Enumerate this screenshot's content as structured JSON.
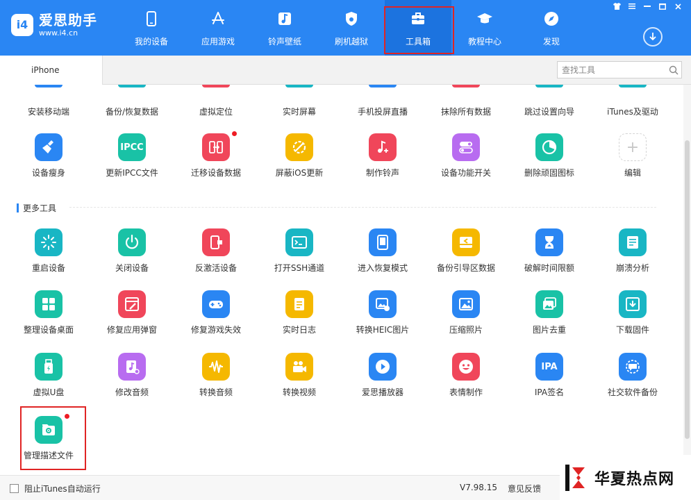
{
  "brand": {
    "name": "爱思助手",
    "url": "www.i4.cn",
    "mark": "i4"
  },
  "nav": [
    {
      "id": "my-device",
      "label": "我的设备",
      "icon": "phone-icon"
    },
    {
      "id": "apps-games",
      "label": "应用游戏",
      "icon": "app-store-icon"
    },
    {
      "id": "ringtones",
      "label": "铃声壁纸",
      "icon": "music-icon"
    },
    {
      "id": "flash-jailbreak",
      "label": "刷机越狱",
      "icon": "shield-icon"
    },
    {
      "id": "toolbox",
      "label": "工具箱",
      "icon": "toolbox-icon",
      "active": true
    },
    {
      "id": "tutorials",
      "label": "教程中心",
      "icon": "graduation-cap-icon"
    },
    {
      "id": "discover",
      "label": "发现",
      "icon": "compass-icon"
    }
  ],
  "device_tab": "iPhone",
  "search": {
    "placeholder": "查找工具"
  },
  "partial_row": [
    {
      "label": "安装移动端",
      "color": "#2a86f3"
    },
    {
      "label": "备份/恢复数据",
      "color": "#19b6c4"
    },
    {
      "label": "虚拟定位",
      "color": "#f0465a"
    },
    {
      "label": "实时屏幕",
      "color": "#19b6c4"
    },
    {
      "label": "手机投屏直播",
      "color": "#2a86f3"
    },
    {
      "label": "抹除所有数据",
      "color": "#f0465a"
    },
    {
      "label": "跳过设置向导",
      "color": "#19b6c4"
    },
    {
      "label": "iTunes及驱动",
      "color": "#19b6c4"
    }
  ],
  "row_top": [
    {
      "label": "设备瘦身",
      "icon": "broom-icon",
      "color": "#2a86f3"
    },
    {
      "label": "更新IPCC文件",
      "icon": "ipcc-icon",
      "text": "IPCC",
      "color": "#19c2a6"
    },
    {
      "label": "迁移设备数据",
      "icon": "transfer-icon",
      "color": "#f0465a",
      "dot": true
    },
    {
      "label": "屏蔽iOS更新",
      "icon": "block-update-icon",
      "color": "#f5b800"
    },
    {
      "label": "制作铃声",
      "icon": "ringtone-icon",
      "color": "#f0465a"
    },
    {
      "label": "设备功能开关",
      "icon": "toggle-icon",
      "color": "#b86cf0"
    },
    {
      "label": "删除顽固图标",
      "icon": "pie-icon",
      "color": "#19c2a6"
    },
    {
      "label": "编辑",
      "icon": "add-icon",
      "text": "+",
      "add": true
    }
  ],
  "section_title": "更多工具",
  "more_tools": [
    [
      {
        "label": "重启设备",
        "icon": "restart-icon",
        "color": "#19b6c4"
      },
      {
        "label": "关闭设备",
        "icon": "power-icon",
        "color": "#19c2a6"
      },
      {
        "label": "反激活设备",
        "icon": "deactivate-icon",
        "color": "#f0465a"
      },
      {
        "label": "打开SSH通道",
        "icon": "terminal-icon",
        "color": "#19b6c4"
      },
      {
        "label": "进入恢复模式",
        "icon": "recovery-icon",
        "color": "#2a86f3"
      },
      {
        "label": "备份引导区数据",
        "icon": "backup-boot-icon",
        "color": "#f5b800"
      },
      {
        "label": "破解时间限额",
        "icon": "hourglass-icon",
        "color": "#2a86f3"
      },
      {
        "label": "崩溃分析",
        "icon": "crash-report-icon",
        "color": "#19b6c4"
      }
    ],
    [
      {
        "label": "整理设备桌面",
        "icon": "grid-icon",
        "color": "#19c2a6"
      },
      {
        "label": "修复应用弹窗",
        "icon": "repair-icon",
        "color": "#f0465a"
      },
      {
        "label": "修复游戏失效",
        "icon": "gamepad-icon",
        "color": "#2a86f3"
      },
      {
        "label": "实时日志",
        "icon": "log-icon",
        "color": "#f5b800"
      },
      {
        "label": "转换HEIC图片",
        "icon": "heic-icon",
        "color": "#2a86f3"
      },
      {
        "label": "压缩照片",
        "icon": "photo-icon",
        "color": "#2a86f3"
      },
      {
        "label": "图片去重",
        "icon": "dedupe-icon",
        "color": "#19c2a6"
      },
      {
        "label": "下载固件",
        "icon": "firmware-download-icon",
        "color": "#19b6c4"
      }
    ],
    [
      {
        "label": "虚拟U盘",
        "icon": "usb-drive-icon",
        "color": "#19c2a6"
      },
      {
        "label": "修改音频",
        "icon": "audio-edit-icon",
        "color": "#b86cf0"
      },
      {
        "label": "转换音频",
        "icon": "waveform-icon",
        "color": "#f5b800"
      },
      {
        "label": "转换视频",
        "icon": "video-icon",
        "color": "#f5b800"
      },
      {
        "label": "爱思播放器",
        "icon": "play-icon",
        "color": "#2a86f3"
      },
      {
        "label": "表情制作",
        "icon": "emoji-icon",
        "color": "#f0465a"
      },
      {
        "label": "IPA签名",
        "icon": "ipa-icon",
        "text": "IPA",
        "color": "#2a86f3"
      },
      {
        "label": "社交软件备份",
        "icon": "chat-backup-icon",
        "color": "#2a86f3"
      }
    ],
    [
      {
        "label": "管理描述文件",
        "icon": "profile-settings-icon",
        "color": "#19c2a6",
        "dot": true
      }
    ]
  ],
  "footer": {
    "checkbox_label": "阻止iTunes自动运行",
    "version": "V7.98.15",
    "feedback": "意见反馈"
  },
  "watermark": "华夏热点网",
  "colors": {
    "primary": "#2a86f3",
    "highlight": "#e02424",
    "badge": "#ee1c24"
  }
}
